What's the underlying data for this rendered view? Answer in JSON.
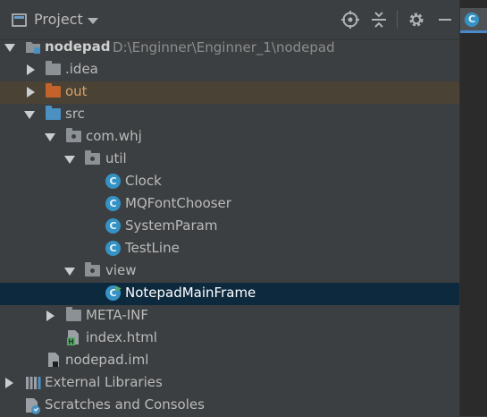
{
  "header": {
    "title": "Project",
    "icons": [
      "target-icon",
      "collapse-icon",
      "gear-icon",
      "minimize-icon"
    ]
  },
  "editor_tab": {
    "icon_letter": "C"
  },
  "tree": {
    "root": {
      "name": "nodepad",
      "path": "D:\\Enginner\\Enginner_1\\nodepad"
    },
    "idea": ".idea",
    "out": "out",
    "src": "src",
    "package": "com.whj",
    "util": "util",
    "util_classes": [
      "Clock",
      "MQFontChooser",
      "SystemParam",
      "TestLine"
    ],
    "view": "view",
    "view_class": "NotepadMainFrame",
    "meta_inf": "META-INF",
    "index_html": "index.html",
    "iml": "nodepad.iml",
    "external_libraries": "External Libraries",
    "scratches": "Scratches and Consoles"
  },
  "colors": {
    "background": "#3c3f41",
    "selection": "#0d293e",
    "excluded_highlight": "#4a4235",
    "class_icon": "#3592c4",
    "folder_orange": "#c3622b",
    "folder_blue": "#4a90c2"
  }
}
